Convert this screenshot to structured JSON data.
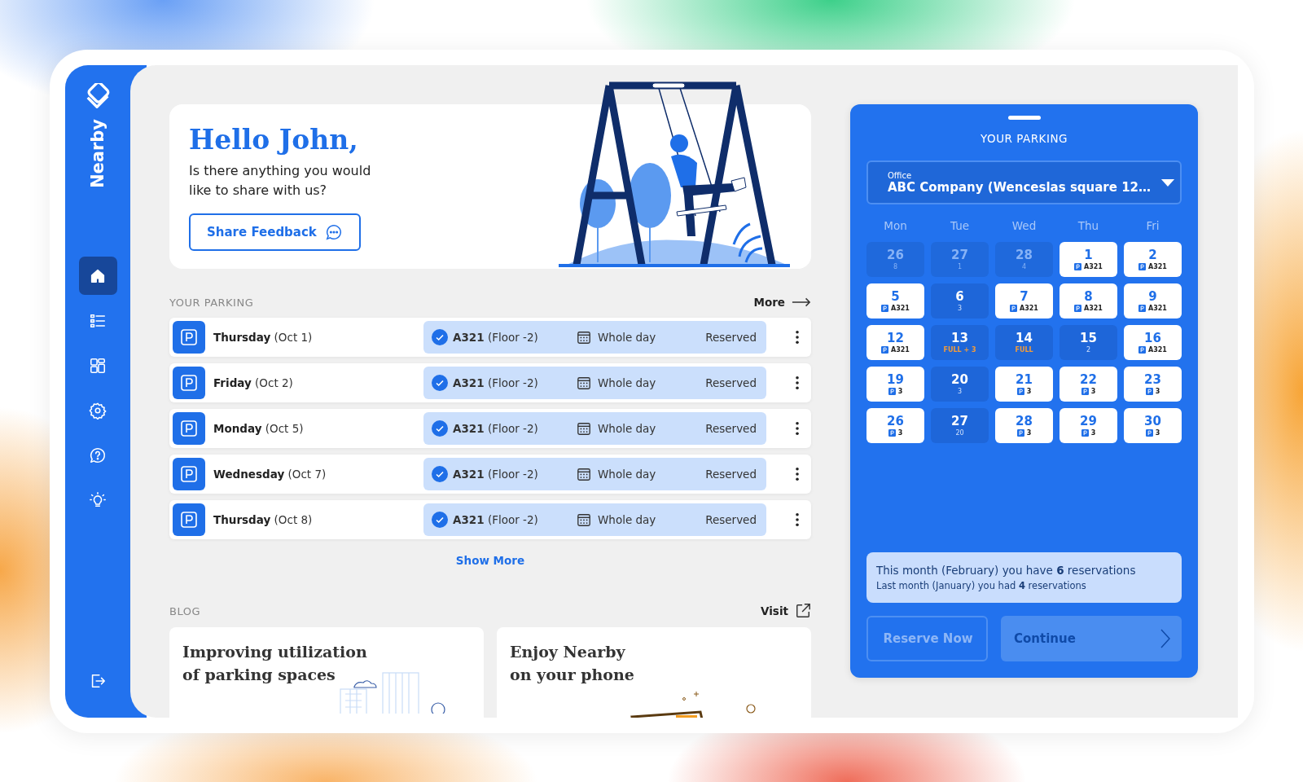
{
  "sidebar": {
    "logo": "Nearby",
    "items": [
      {
        "kind": "home",
        "selected": true
      },
      {
        "kind": "list",
        "selected": false
      },
      {
        "kind": "dashboard",
        "selected": false
      },
      {
        "kind": "settings",
        "selected": false
      },
      {
        "kind": "help",
        "selected": false
      },
      {
        "kind": "lightbulb",
        "selected": false
      }
    ],
    "bottom": [
      {
        "kind": "logout",
        "selected": false
      }
    ]
  },
  "greeting": {
    "title": "Hello John,",
    "message": "Is there anything you would like to share with us?",
    "button": "Share Feedback"
  },
  "parking": {
    "heading": "YOUR PARKING",
    "more": "More",
    "rows": [
      {
        "day": "Thursday",
        "date": "(Oct 1)",
        "spot": "A321",
        "floor": "(Floor -2)",
        "duration": "Whole day",
        "status": "Reserved",
        "confirmed": true
      },
      {
        "day": "Friday",
        "date": "(Oct 2)",
        "spot": "A321",
        "floor": "(Floor -2)",
        "duration": "Whole day",
        "status": "Reserved",
        "confirmed": true
      },
      {
        "day": "Monday",
        "date": "(Oct 5)",
        "spot": "A321",
        "floor": "(Floor -2)",
        "duration": "Whole day",
        "status": "Reserved",
        "confirmed": true
      },
      {
        "day": "Wednesday",
        "date": "(Oct 7)",
        "spot": "A321",
        "floor": "(Floor -2)",
        "duration": "Whole day",
        "status": "Reserved",
        "confirmed": true
      },
      {
        "day": "Thursday",
        "date": "(Oct 8)",
        "spot": "A321",
        "floor": "(Floor -2)",
        "duration": "Whole day",
        "status": "Reserved",
        "confirmed": true
      }
    ],
    "show_more": "Show More"
  },
  "blog": {
    "heading": "BLOG",
    "visit": "Visit",
    "posts": [
      {
        "title_lines": [
          "Improving utilization",
          "of parking spaces"
        ]
      },
      {
        "title_lines": [
          "Enjoy Nearby",
          "on your phone"
        ]
      }
    ]
  },
  "panel": {
    "title": "YOUR PARKING",
    "office": {
      "label": "Office",
      "value": "ABC Company (Wenceslas square 12…"
    },
    "weekdays": [
      "Mon",
      "Tue",
      "Wed",
      "Thu",
      "Fri"
    ],
    "days": [
      {
        "day": "26",
        "kind": "past",
        "note": "8"
      },
      {
        "day": "27",
        "kind": "past",
        "note": "1"
      },
      {
        "day": "28",
        "kind": "past",
        "note": "4"
      },
      {
        "day": "1",
        "kind": "spot",
        "note": "A321"
      },
      {
        "day": "2",
        "kind": "spot",
        "note": "A321"
      },
      {
        "day": "5",
        "kind": "spot",
        "note": "A321"
      },
      {
        "day": "6",
        "kind": "open",
        "note": "3"
      },
      {
        "day": "7",
        "kind": "spot",
        "note": "A321"
      },
      {
        "day": "8",
        "kind": "spot",
        "note": "A321"
      },
      {
        "day": "9",
        "kind": "spot",
        "note": "A321"
      },
      {
        "day": "12",
        "kind": "spot",
        "note": "A321"
      },
      {
        "day": "13",
        "kind": "full",
        "note": "FULL + 3"
      },
      {
        "day": "14",
        "kind": "full",
        "note": "FULL"
      },
      {
        "day": "15",
        "kind": "open",
        "note": "2"
      },
      {
        "day": "16",
        "kind": "spot",
        "note": "A321"
      },
      {
        "day": "19",
        "kind": "spot",
        "note": "3"
      },
      {
        "day": "20",
        "kind": "open",
        "note": "3"
      },
      {
        "day": "21",
        "kind": "spot",
        "note": "3"
      },
      {
        "day": "22",
        "kind": "spot",
        "note": "3"
      },
      {
        "day": "23",
        "kind": "spot",
        "note": "3"
      },
      {
        "day": "26",
        "kind": "spot",
        "note": "3"
      },
      {
        "day": "27",
        "kind": "open",
        "note": "20"
      },
      {
        "day": "28",
        "kind": "spot",
        "note": "3"
      },
      {
        "day": "29",
        "kind": "spot",
        "note": "3"
      },
      {
        "day": "30",
        "kind": "spot",
        "note": "3"
      }
    ],
    "summary": [
      "This month (February) you have **6** reservations",
      "Last month (January) you had **4** reservations"
    ],
    "buttons": [
      {
        "label": "Reserve Now",
        "kind": "outline",
        "disabled": true
      },
      {
        "label": "Continue",
        "kind": "primary",
        "disabled": true
      }
    ]
  }
}
